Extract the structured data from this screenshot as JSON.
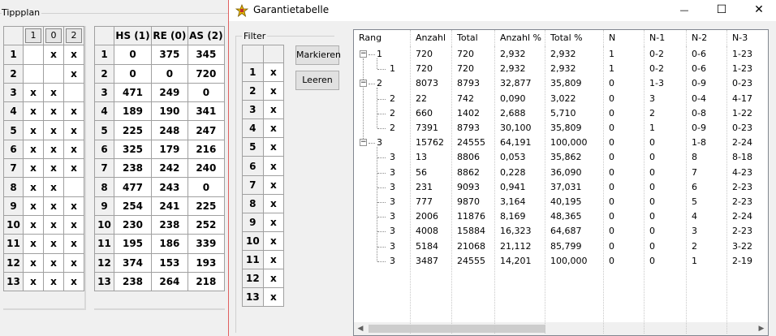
{
  "tippplan": {
    "title": "Tippplan",
    "col_headers": [
      "1",
      "0",
      "2"
    ],
    "rows": [
      {
        "n": "1",
        "c": [
          "",
          "x",
          "x"
        ]
      },
      {
        "n": "2",
        "c": [
          "",
          "",
          "x"
        ]
      },
      {
        "n": "3",
        "c": [
          "x",
          "x",
          ""
        ]
      },
      {
        "n": "4",
        "c": [
          "x",
          "x",
          "x"
        ]
      },
      {
        "n": "5",
        "c": [
          "x",
          "x",
          "x"
        ]
      },
      {
        "n": "6",
        "c": [
          "x",
          "x",
          "x"
        ]
      },
      {
        "n": "7",
        "c": [
          "x",
          "x",
          "x"
        ]
      },
      {
        "n": "8",
        "c": [
          "x",
          "x",
          ""
        ]
      },
      {
        "n": "9",
        "c": [
          "x",
          "x",
          "x"
        ]
      },
      {
        "n": "10",
        "c": [
          "x",
          "x",
          "x"
        ]
      },
      {
        "n": "11",
        "c": [
          "x",
          "x",
          "x"
        ]
      },
      {
        "n": "12",
        "c": [
          "x",
          "x",
          "x"
        ]
      },
      {
        "n": "13",
        "c": [
          "x",
          "x",
          "x"
        ]
      }
    ]
  },
  "stats": {
    "col_headers": [
      "HS (1)",
      "RE (0)",
      "AS (2)"
    ],
    "rows": [
      {
        "n": "1",
        "c": [
          "0",
          "375",
          "345"
        ]
      },
      {
        "n": "2",
        "c": [
          "0",
          "0",
          "720"
        ]
      },
      {
        "n": "3",
        "c": [
          "471",
          "249",
          "0"
        ]
      },
      {
        "n": "4",
        "c": [
          "189",
          "190",
          "341"
        ]
      },
      {
        "n": "5",
        "c": [
          "225",
          "248",
          "247"
        ]
      },
      {
        "n": "6",
        "c": [
          "325",
          "179",
          "216"
        ]
      },
      {
        "n": "7",
        "c": [
          "238",
          "242",
          "240"
        ]
      },
      {
        "n": "8",
        "c": [
          "477",
          "243",
          "0"
        ]
      },
      {
        "n": "9",
        "c": [
          "254",
          "241",
          "225"
        ]
      },
      {
        "n": "10",
        "c": [
          "230",
          "238",
          "252"
        ]
      },
      {
        "n": "11",
        "c": [
          "195",
          "186",
          "339"
        ]
      },
      {
        "n": "12",
        "c": [
          "374",
          "153",
          "193"
        ]
      },
      {
        "n": "13",
        "c": [
          "238",
          "264",
          "218"
        ]
      }
    ]
  },
  "window": {
    "title": "Garantietabelle",
    "icons": {
      "minimize": "minimize-icon",
      "maximize": "maximize-icon",
      "close": "close-icon",
      "app": "app-icon"
    },
    "min_glyph": "—",
    "max_glyph": "☐",
    "close_glyph": "✕"
  },
  "filter": {
    "title": "Filter",
    "rows": [
      {
        "n": "1",
        "v": "x"
      },
      {
        "n": "2",
        "v": "x"
      },
      {
        "n": "3",
        "v": "x"
      },
      {
        "n": "4",
        "v": "x"
      },
      {
        "n": "5",
        "v": "x"
      },
      {
        "n": "6",
        "v": "x"
      },
      {
        "n": "7",
        "v": "x"
      },
      {
        "n": "8",
        "v": "x"
      },
      {
        "n": "9",
        "v": "x"
      },
      {
        "n": "10",
        "v": "x"
      },
      {
        "n": "11",
        "v": "x"
      },
      {
        "n": "12",
        "v": "x"
      },
      {
        "n": "13",
        "v": "x"
      }
    ],
    "markieren_label": "Markieren",
    "leeren_label": "Leeren"
  },
  "guarantee": {
    "columns": [
      "Rang",
      "Anzahl",
      "Total",
      "Anzahl %",
      "Total %",
      "N",
      "N-1",
      "N-2",
      "N-3"
    ],
    "rows": [
      {
        "level": 0,
        "expander": "−",
        "rang": "1",
        "c": [
          "720",
          "720",
          "2,932",
          "2,932",
          "1",
          "0-2",
          "0-6",
          "1-23"
        ]
      },
      {
        "level": 1,
        "rang": "1",
        "c": [
          "720",
          "720",
          "2,932",
          "2,932",
          "1",
          "0-2",
          "0-6",
          "1-23"
        ]
      },
      {
        "level": 0,
        "expander": "−",
        "rang": "2",
        "c": [
          "8073",
          "8793",
          "32,877",
          "35,809",
          "0",
          "1-3",
          "0-9",
          "0-23"
        ]
      },
      {
        "level": 1,
        "rang": "2",
        "c": [
          "22",
          "742",
          "0,090",
          "3,022",
          "0",
          "3",
          "0-4",
          "4-17"
        ]
      },
      {
        "level": 1,
        "rang": "2",
        "c": [
          "660",
          "1402",
          "2,688",
          "5,710",
          "0",
          "2",
          "0-8",
          "1-22"
        ]
      },
      {
        "level": 1,
        "rang": "2",
        "c": [
          "7391",
          "8793",
          "30,100",
          "35,809",
          "0",
          "1",
          "0-9",
          "0-23"
        ]
      },
      {
        "level": 0,
        "expander": "−",
        "rang": "3",
        "c": [
          "15762",
          "24555",
          "64,191",
          "100,000",
          "0",
          "0",
          "1-8",
          "2-24"
        ]
      },
      {
        "level": 1,
        "rang": "3",
        "c": [
          "13",
          "8806",
          "0,053",
          "35,862",
          "0",
          "0",
          "8",
          "8-18"
        ]
      },
      {
        "level": 1,
        "rang": "3",
        "c": [
          "56",
          "8862",
          "0,228",
          "36,090",
          "0",
          "0",
          "7",
          "4-23"
        ]
      },
      {
        "level": 1,
        "rang": "3",
        "c": [
          "231",
          "9093",
          "0,941",
          "37,031",
          "0",
          "0",
          "6",
          "2-23"
        ]
      },
      {
        "level": 1,
        "rang": "3",
        "c": [
          "777",
          "9870",
          "3,164",
          "40,195",
          "0",
          "0",
          "5",
          "2-23"
        ]
      },
      {
        "level": 1,
        "rang": "3",
        "c": [
          "2006",
          "11876",
          "8,169",
          "48,365",
          "0",
          "0",
          "4",
          "2-24"
        ]
      },
      {
        "level": 1,
        "rang": "3",
        "c": [
          "4008",
          "15884",
          "16,323",
          "64,687",
          "0",
          "0",
          "3",
          "2-23"
        ]
      },
      {
        "level": 1,
        "rang": "3",
        "c": [
          "5184",
          "21068",
          "21,112",
          "85,799",
          "0",
          "0",
          "2",
          "3-22"
        ]
      },
      {
        "level": 1,
        "rang": "3",
        "c": [
          "3487",
          "24555",
          "14,201",
          "100,000",
          "0",
          "0",
          "1",
          "2-19"
        ]
      }
    ],
    "scroll": {
      "left_glyph": "◀",
      "right_glyph": "▶",
      "thumb_fraction": 0.46
    }
  }
}
